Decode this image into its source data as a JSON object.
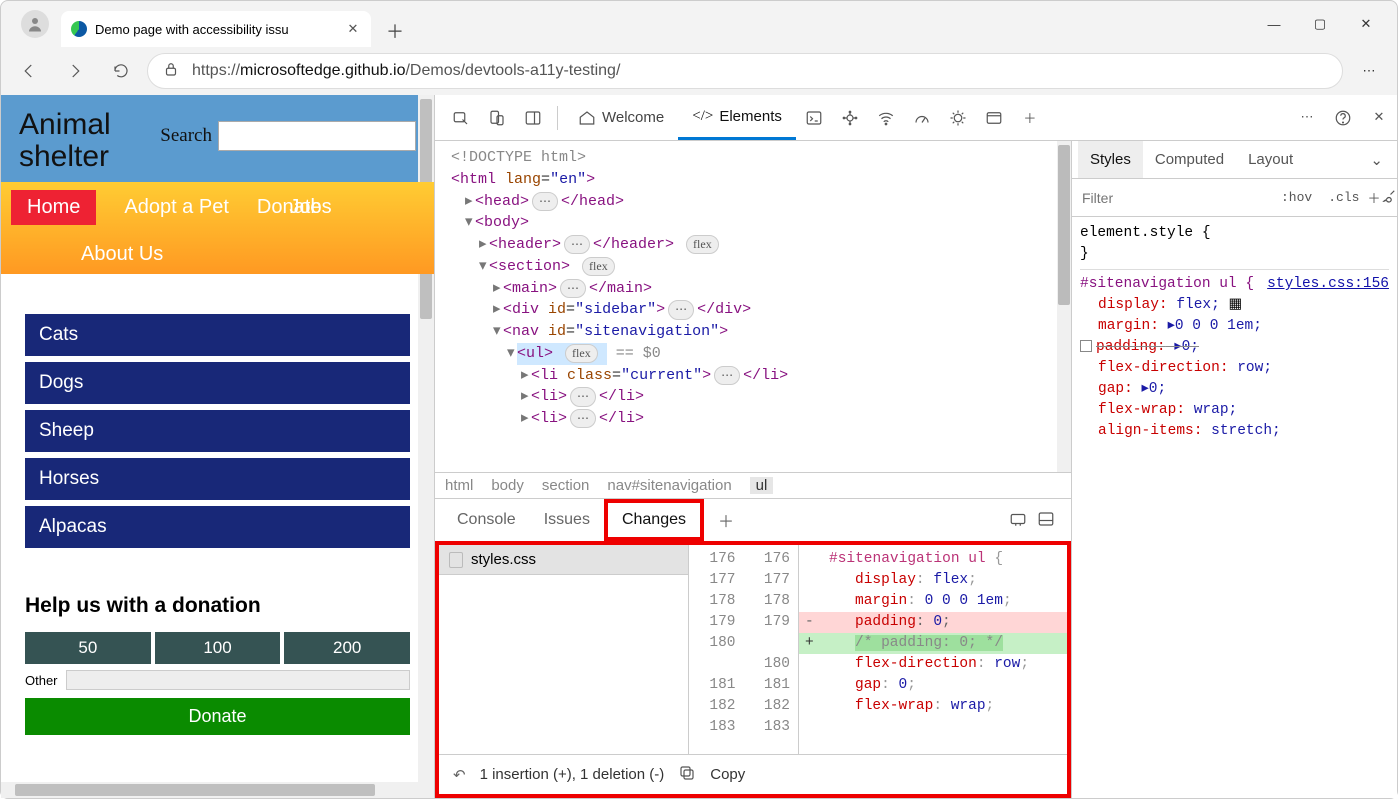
{
  "browser": {
    "tab_title": "Demo page with accessibility issu",
    "url_prefix": "https://",
    "url_host": "microsoftedge.github.io",
    "url_path": "/Demos/devtools-a11y-testing/"
  },
  "page": {
    "brand_line1": "Animal",
    "brand_line2": "shelter",
    "search_label": "Search",
    "menu": {
      "home": "Home",
      "adopt": "Adopt a Pet",
      "donate": "Donate",
      "jobs": "Jobs",
      "about": "About Us"
    },
    "side_items": [
      "Cats",
      "Dogs",
      "Sheep",
      "Horses",
      "Alpacas"
    ],
    "donation_heading": "Help us with a donation",
    "amounts": [
      "50",
      "100",
      "200"
    ],
    "other_label": "Other",
    "donate_btn": "Donate"
  },
  "devtools": {
    "tabs": {
      "welcome": "Welcome",
      "elements": "Elements"
    },
    "dom": {
      "doctype": "<!DOCTYPE html>",
      "html_open": "<html lang=\"en\">",
      "head": "<head>",
      "head_close": "</head>",
      "body": "<body>",
      "header": "<header>",
      "header_close": "</header>",
      "flex_pill": "flex",
      "section": "<section>",
      "main": "<main>",
      "main_close": "</main>",
      "div_sidebar": "<div id=\"sidebar\">",
      "div_close": "</div>",
      "nav": "<nav id=\"sitenavigation\">",
      "ul": "<ul>",
      "eq0": "== $0",
      "li_current": "<li class=\"current\">",
      "li_close": "</li>",
      "li": "<li>",
      "dots": "⋯"
    },
    "crumbs": [
      "html",
      "body",
      "section",
      "nav#sitenavigation",
      "ul"
    ],
    "styles": {
      "tabs": {
        "styles": "Styles",
        "computed": "Computed",
        "layout": "Layout"
      },
      "filter_placeholder": "Filter",
      "hov": ":hov",
      "cls": ".cls",
      "element_style": "element.style {",
      "brace_close": "}",
      "rule_selector": "#sitenavigation ul {",
      "rule_link": "styles.css:156",
      "props": {
        "display": "display:",
        "display_v": "flex;",
        "margin": "margin:",
        "margin_v": "▸0 0 0 1em;",
        "padding": "padding:",
        "padding_v": "▸0;",
        "flexdir": "flex-direction:",
        "flexdir_v": "row;",
        "gap": "gap:",
        "gap_v": "▸0;",
        "flexwrap": "flex-wrap:",
        "flexwrap_v": "wrap;",
        "align": "align-items:",
        "align_v": "stretch;"
      }
    },
    "drawer": {
      "tabs": {
        "console": "Console",
        "issues": "Issues",
        "changes": "Changes"
      },
      "filename": "styles.css",
      "lines_left": [
        "176",
        "177",
        "178",
        "179",
        "180",
        "",
        "181",
        "182",
        "183"
      ],
      "lines_right": [
        "176",
        "177",
        "178",
        "179",
        "",
        "180",
        "181",
        "182",
        "183"
      ],
      "code": {
        "l1_sel": "#sitenavigation ul",
        "l1_brace": " {",
        "l2": "display: flex;",
        "l3": "margin: 0 0 0 1em;",
        "removed": "padding: 0;",
        "added": "/* padding: 0; */",
        "l5": "flex-direction: row;",
        "l6": "gap: 0;",
        "l7": "flex-wrap: wrap;"
      },
      "footer": "1 insertion (+), 1 deletion (-)",
      "copy": "Copy"
    }
  }
}
